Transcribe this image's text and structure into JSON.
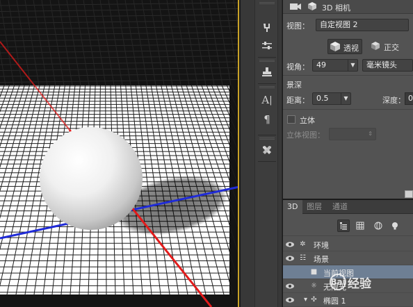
{
  "properties": {
    "header_title": "3D 相机",
    "view_label": "视图：",
    "view_value": "自定视图 2",
    "perspective_label": "透视",
    "orthographic_label": "正交",
    "fov_label": "视角：",
    "fov_value": "49",
    "fov_unit_value": "毫米镜头",
    "dof_section": "景深",
    "distance_label": "距离：",
    "distance_value": "0.5",
    "depth_label": "深度：",
    "depth_value": "0",
    "stereo_label": "立体",
    "stereo_view_label": "立体视图："
  },
  "toolstrip": {
    "icons": [
      "brush-tool-icon",
      "adjust-sliders-icon",
      "stamp-icon",
      "character-icon",
      "paragraph-icon",
      "tools-icon"
    ]
  },
  "panel3d": {
    "tabs": [
      "3D",
      "图层",
      "通道"
    ],
    "active_tab": "3D",
    "layers": [
      {
        "label": "环境",
        "icon": "environment-icon"
      },
      {
        "label": "场景",
        "icon": "scene-icon"
      },
      {
        "label": "当前视图",
        "icon": "camera-icon",
        "selected": true
      },
      {
        "label": "无限光",
        "icon": "infinite-light-icon"
      },
      {
        "label": "椭圆 1",
        "icon": "mesh-icon"
      }
    ]
  },
  "watermark": {
    "text": "经验"
  },
  "colors": {
    "axis_red": "#e21b1b",
    "axis_blue": "#1f2bd8",
    "panel_bg": "#535353",
    "selection": "#6e7f94",
    "border_accent": "#c9a227"
  }
}
